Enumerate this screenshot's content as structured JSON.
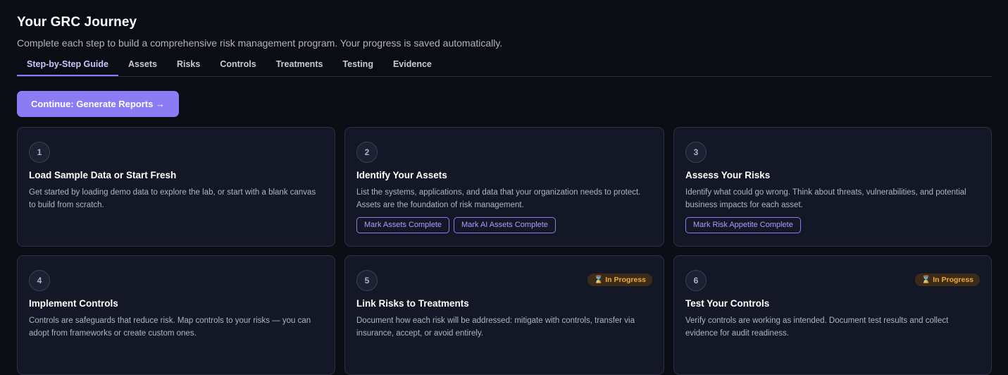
{
  "header": {
    "title": "Your GRC Journey",
    "subtitle": "Complete each step to build a comprehensive risk management program. Your progress is saved automatically."
  },
  "tabs": [
    {
      "label": "Step-by-Step Guide",
      "active": true
    },
    {
      "label": "Assets"
    },
    {
      "label": "Risks"
    },
    {
      "label": "Controls"
    },
    {
      "label": "Treatments"
    },
    {
      "label": "Testing"
    },
    {
      "label": "Evidence"
    }
  ],
  "continue_label": "Continue: Generate Reports →",
  "colors": {
    "accent": "#8b7cf6",
    "badge_text": "#f0a83a",
    "background": "#0b0d14",
    "card": "#141826"
  },
  "steps": [
    {
      "number": "1",
      "title": "Load Sample Data or Start Fresh",
      "description": "Get started by loading demo data to explore the lab, or start with a blank canvas to build from scratch."
    },
    {
      "number": "2",
      "title": "Identify Your Assets",
      "description": "List the systems, applications, and data that your organization needs to protect. Assets are the foundation of risk management.",
      "actions": [
        "Mark Assets Complete",
        "Mark AI Assets Complete"
      ]
    },
    {
      "number": "3",
      "title": "Assess Your Risks",
      "description": "Identify what could go wrong. Think about threats, vulnerabilities, and potential business impacts for each asset.",
      "actions": [
        "Mark Risk Appetite Complete"
      ]
    },
    {
      "number": "4",
      "title": "Implement Controls",
      "description": "Controls are safeguards that reduce risk. Map controls to your risks — you can adopt from frameworks or create custom ones."
    },
    {
      "number": "5",
      "title": "Link Risks to Treatments",
      "description": "Document how each risk will be addressed: mitigate with controls, transfer via insurance, accept, or avoid entirely.",
      "badge": "⌛ In Progress"
    },
    {
      "number": "6",
      "title": "Test Your Controls",
      "description": "Verify controls are working as intended. Document test results and collect evidence for audit readiness.",
      "badge": "⌛ In Progress"
    }
  ]
}
